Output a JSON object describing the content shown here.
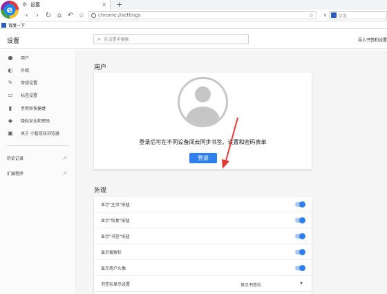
{
  "browser": {
    "tab_title": "设置",
    "tab_close": "×",
    "new_tab": "+",
    "address": "chrome://settings",
    "search_placeholder": "百度",
    "bookmark_label": "百度一下"
  },
  "settings": {
    "title": "设置",
    "search_placeholder": "在设置中搜索",
    "import_label": "导入书签和设置"
  },
  "sidebar": {
    "items": [
      {
        "label": "用户",
        "icon": "person-icon"
      },
      {
        "label": "外观",
        "icon": "palette-icon"
      },
      {
        "label": "常规设置",
        "icon": "wrench-icon"
      },
      {
        "label": "标签设置",
        "icon": "tab-icon"
      },
      {
        "label": "手势和快捷键",
        "icon": "mouse-icon"
      },
      {
        "label": "隐私安全和密码",
        "icon": "shield-icon"
      },
      {
        "label": "关于 小智双核浏览器",
        "icon": "info-icon"
      }
    ],
    "history": "历史记录",
    "extensions": "扩展程序"
  },
  "user_section": {
    "title": "用户",
    "signin_text": "登录后可在不同设备间云同步书签、设置和密码表单",
    "signin_button": "登录"
  },
  "appearance_section": {
    "title": "外观",
    "toggles": [
      {
        "label": "显示\"主页\"按钮",
        "on": true
      },
      {
        "label": "显示\"恢复\"按钮",
        "on": true
      },
      {
        "label": "显示\"书签\"按钮",
        "on": true
      },
      {
        "label": "显示搜索栏",
        "on": true
      },
      {
        "label": "显示用户头像",
        "on": true
      }
    ],
    "bookmark_bar_label": "书签栏显示设置",
    "bookmark_bar_value": "显示书签栏"
  },
  "colors": {
    "accent": "#2f80ed",
    "logo_blue": "#1e88e5"
  }
}
